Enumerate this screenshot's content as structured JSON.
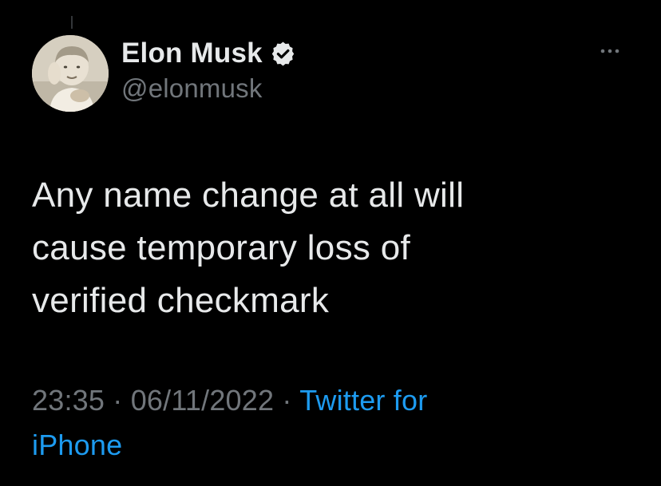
{
  "author": {
    "display_name": "Elon Musk",
    "handle": "@elonmusk",
    "verified": true,
    "avatar_icon": "profile-photo-child"
  },
  "tweet": {
    "text_lines": [
      "Any name change at all will",
      "cause temporary loss of",
      "verified checkmark"
    ],
    "time": "23:35",
    "separator": "·",
    "date": "06/11/2022",
    "source_line1": "Twitter for",
    "source_line2": "iPhone"
  },
  "icons": {
    "verified": "verified-badge-icon",
    "more": "more-options-icon"
  },
  "colors": {
    "background": "#000000",
    "primary_text": "#e7e9ea",
    "secondary_text": "#71767b",
    "link": "#1d9bf0"
  }
}
